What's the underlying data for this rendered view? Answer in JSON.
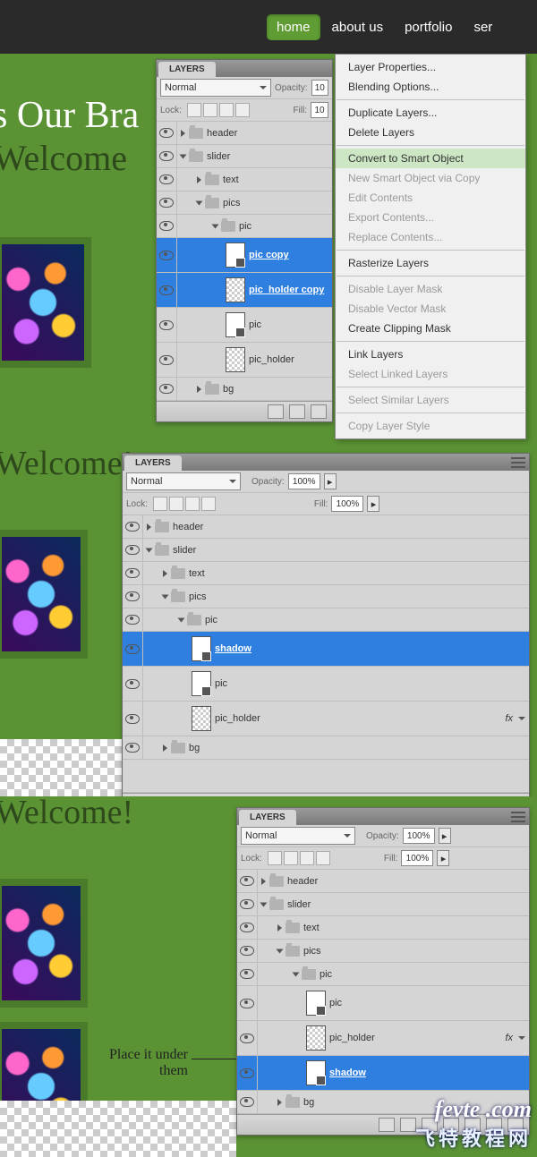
{
  "nav": {
    "items": [
      "home",
      "about us",
      "portfolio",
      "ser"
    ],
    "active": 0
  },
  "hero": {
    "line1": "s Our Bra",
    "line2": "Welcome",
    "line2b": "Welcome!",
    "line2c": "Welcome!"
  },
  "panel": {
    "tab": "LAYERS",
    "blend": "Normal",
    "opacity_label": "Opacity:",
    "opacity_val": "100%",
    "opacity_val_short": "10",
    "lock_label": "Lock:",
    "fill_label": "Fill:",
    "fill_val": "100%",
    "fill_val_short": "10"
  },
  "layers1": [
    {
      "name": "header",
      "type": "folder",
      "open": false,
      "indent": 0
    },
    {
      "name": "slider",
      "type": "folder",
      "open": true,
      "indent": 0
    },
    {
      "name": "text",
      "type": "folder",
      "open": false,
      "indent": 1
    },
    {
      "name": "pics",
      "type": "folder",
      "open": true,
      "indent": 1
    },
    {
      "name": "pic",
      "type": "folder",
      "open": true,
      "indent": 2
    },
    {
      "name": "pic copy",
      "type": "smart",
      "indent": 3,
      "selected": true,
      "tall": true
    },
    {
      "name": "pic_holder copy",
      "type": "chk",
      "indent": 3,
      "selected": true,
      "tall": true
    },
    {
      "name": "pic",
      "type": "smart",
      "indent": 3,
      "tall": true
    },
    {
      "name": "pic_holder",
      "type": "chk",
      "indent": 3,
      "tall": true
    },
    {
      "name": "bg",
      "type": "folder",
      "open": false,
      "indent": 1
    }
  ],
  "layers2": [
    {
      "name": "header",
      "type": "folder",
      "open": false,
      "indent": 0
    },
    {
      "name": "slider",
      "type": "folder",
      "open": true,
      "indent": 0
    },
    {
      "name": "text",
      "type": "folder",
      "open": false,
      "indent": 1
    },
    {
      "name": "pics",
      "type": "folder",
      "open": true,
      "indent": 1
    },
    {
      "name": "pic",
      "type": "folder",
      "open": true,
      "indent": 2
    },
    {
      "name": "shadow",
      "type": "smart",
      "indent": 3,
      "selected": true,
      "tall": true
    },
    {
      "name": "pic",
      "type": "smart",
      "indent": 3,
      "tall": true
    },
    {
      "name": "pic_holder",
      "type": "chk",
      "indent": 3,
      "tall": true,
      "fx": true
    },
    {
      "name": "bg",
      "type": "folder",
      "open": false,
      "indent": 1
    }
  ],
  "layers3": [
    {
      "name": "header",
      "type": "folder",
      "open": false,
      "indent": 0
    },
    {
      "name": "slider",
      "type": "folder",
      "open": true,
      "indent": 0
    },
    {
      "name": "text",
      "type": "folder",
      "open": false,
      "indent": 1
    },
    {
      "name": "pics",
      "type": "folder",
      "open": true,
      "indent": 1
    },
    {
      "name": "pic",
      "type": "folder",
      "open": true,
      "indent": 2
    },
    {
      "name": "pic",
      "type": "smart",
      "indent": 3,
      "tall": true
    },
    {
      "name": "pic_holder",
      "type": "chk",
      "indent": 3,
      "tall": true,
      "fx": true
    },
    {
      "name": "shadow",
      "type": "smart",
      "indent": 3,
      "selected": true,
      "tall": true
    },
    {
      "name": "bg",
      "type": "folder",
      "open": false,
      "indent": 1
    }
  ],
  "ctx": [
    {
      "t": "Layer Properties..."
    },
    {
      "t": "Blending Options..."
    },
    {
      "sep": true
    },
    {
      "t": "Duplicate Layers..."
    },
    {
      "t": "Delete Layers"
    },
    {
      "sep": true
    },
    {
      "t": "Convert to Smart Object",
      "hov": true
    },
    {
      "t": "New Smart Object via Copy",
      "dis": true
    },
    {
      "t": "Edit Contents",
      "dis": true
    },
    {
      "t": "Export Contents...",
      "dis": true
    },
    {
      "t": "Replace Contents...",
      "dis": true
    },
    {
      "sep": true
    },
    {
      "t": "Rasterize Layers"
    },
    {
      "sep": true
    },
    {
      "t": "Disable Layer Mask",
      "dis": true
    },
    {
      "t": "Disable Vector Mask",
      "dis": true
    },
    {
      "t": "Create Clipping Mask"
    },
    {
      "sep": true
    },
    {
      "t": "Link Layers"
    },
    {
      "t": "Select Linked Layers",
      "dis": true
    },
    {
      "sep": true
    },
    {
      "t": "Select Similar Layers",
      "dis": true
    },
    {
      "sep": true
    },
    {
      "t": "Copy Layer Style",
      "dis": true
    }
  ],
  "annot": "Place it under\nthem",
  "watermark": {
    "l1": "fevte .com",
    "l2": "飞特教程网"
  }
}
